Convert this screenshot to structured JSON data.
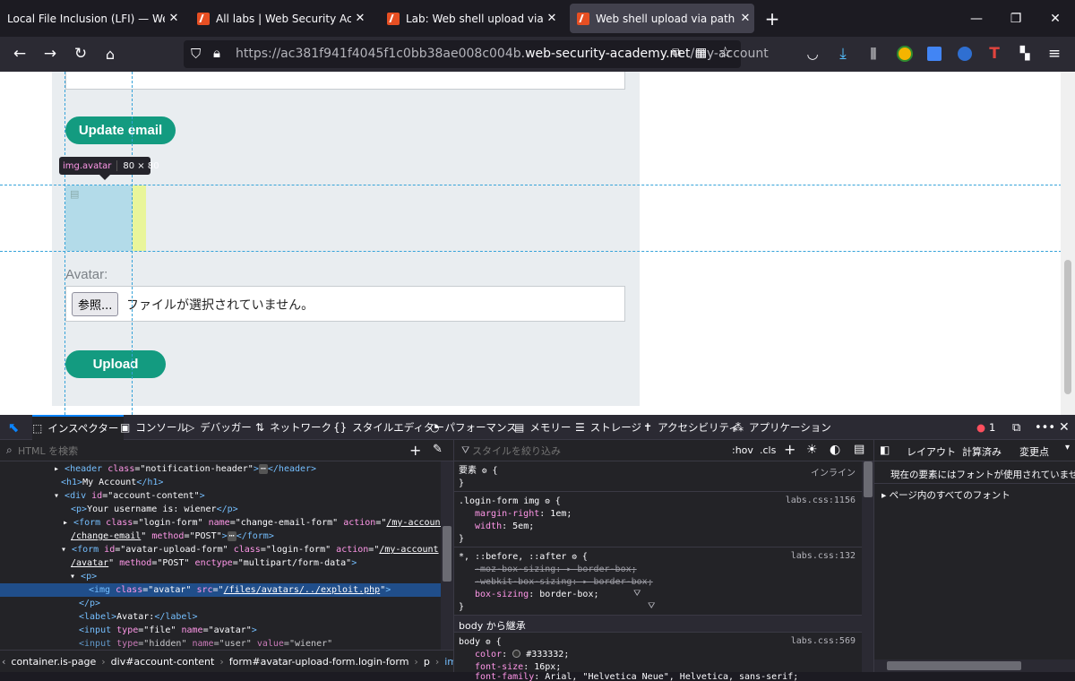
{
  "browser": {
    "tabs": [
      {
        "title": "Local File Inclusion (LFI) — Web App",
        "active": false,
        "favicon": false
      },
      {
        "title": "All labs | Web Security Academy",
        "active": false,
        "favicon": true
      },
      {
        "title": "Lab: Web shell upload via path t",
        "active": false,
        "favicon": true
      },
      {
        "title": "Web shell upload via path trave",
        "active": true,
        "favicon": true
      }
    ],
    "url_prefix": "https://ac381f941f4045f1c0bb38ae008c004b.",
    "url_domain": "web-security-academy.net",
    "url_path": "/my-account"
  },
  "page": {
    "update_email_label": "Update email",
    "avatar_label": "Avatar:",
    "browse_label": "参照...",
    "file_status": "ファイルが選択されていません。",
    "upload_label": "Upload",
    "tooltip_name": "img.avatar",
    "tooltip_size": "80 × 80"
  },
  "devtools": {
    "tabs": [
      {
        "icon": "⬚",
        "label": "インスペクター",
        "active": true
      },
      {
        "icon": "▣",
        "label": "コンソール"
      },
      {
        "icon": "▷",
        "label": "デバッガー"
      },
      {
        "icon": "⇅",
        "label": "ネットワーク"
      },
      {
        "icon": "{}",
        "label": "スタイルエディター"
      },
      {
        "icon": "◔",
        "label": "パフォーマンス"
      },
      {
        "icon": "▤",
        "label": "メモリー"
      },
      {
        "icon": "☰",
        "label": "ストレージ"
      },
      {
        "icon": "✝",
        "label": "アクセシビリティ"
      },
      {
        "icon": "⁂",
        "label": "アプリケーション"
      }
    ],
    "error_count": "1",
    "html_search_placeholder": "HTML を検索",
    "styles_filter_placeholder": "スタイルを絞り込み",
    "hov": ":hov",
    "cls": ".cls",
    "breadcrumbs": [
      "container.is-page",
      "div#account-content",
      "form#avatar-upload-form.login-form",
      "p",
      "img.avatar"
    ],
    "layout_tabs": [
      "レイアウト",
      "計算済み",
      "変更点"
    ],
    "fonts_message": "現在の要素にはフォントが使用されていません。",
    "fonts_all": "ページ内のすべてのフォント",
    "markup": {
      "header_tag": "header",
      "header_class": "notification-header",
      "h1_text": "My Account",
      "div_id": "account-content",
      "p_text": "Your username is: wiener",
      "form1_class": "login-form",
      "form1_name": "change-email-form",
      "form1_action": "/my-account/change-email",
      "form1_action_a": "/my-account",
      "form1_action_b": "/change-email",
      "form1_method": "POST",
      "form2_id": "avatar-upload-form",
      "form2_class": "login-form",
      "form2_action_a": "/my-account",
      "form2_action_b": "/avatar",
      "form2_method": "POST",
      "form2_enctype": "multipart/form-data",
      "img_class": "avatar",
      "img_src": "/files/avatars/../exploit.php",
      "label_text": "Avatar:",
      "input1_type": "file",
      "input1_name": "avatar",
      "input2_type": "hidden",
      "input2_name": "user",
      "input2_value": "wiener"
    },
    "rules": {
      "element_label": "要素",
      "inline_label": "インライン",
      "rule1_selector": ".login-form img",
      "rule1_source": "labs.css:1156",
      "rule1_props": [
        [
          "margin-right",
          "1em"
        ],
        [
          "width",
          "5em"
        ]
      ],
      "rule2_selector": "*, ::before, ::after",
      "rule2_source": "labs.css:132",
      "rule2_props": [
        [
          "-moz-box-sizing",
          "border-box"
        ],
        [
          "-webkit-box-sizing",
          "border-box"
        ],
        [
          "box-sizing",
          "border-box"
        ]
      ],
      "inherit_label": "body から継承",
      "rule3_selector": "body",
      "rule3_source": "labs.css:569",
      "rule3_color": "#333332",
      "rule3_font_size": "16px",
      "rule3_font_family": "Arial, \"Helvetica Neue\", Helvetica, sans-serif"
    }
  },
  "colors": {
    "accent_button": "#139b80",
    "page_container": "#e9edf0",
    "highlight_blue": "#b3dbe9",
    "highlight_yellow": "#e9f59a",
    "selected_row": "#204e8a"
  }
}
